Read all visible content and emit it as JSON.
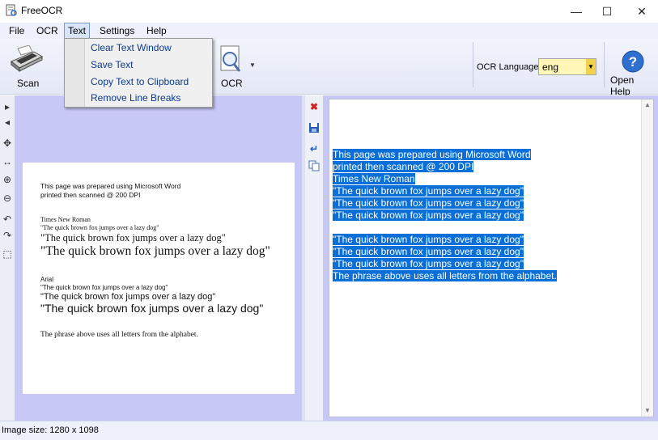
{
  "window": {
    "title": "FreeOCR",
    "minimize_glyph": "—",
    "maximize_glyph": "☐",
    "close_glyph": "✕"
  },
  "menu": {
    "items": [
      "File",
      "OCR",
      "Text",
      "Settings",
      "Help"
    ],
    "text_dropdown": [
      "Clear Text Window",
      "Save Text",
      "Copy Text to Clipboard",
      "Remove Line Breaks"
    ]
  },
  "toolbar": {
    "scan_label": "Scan",
    "ocr_label": "OCR",
    "ocr_language_label": "OCR Language:",
    "ocr_language_value": "eng",
    "help_label": "Open Help"
  },
  "document": {
    "lines": [
      "This page was prepared using Microsoft Word",
      "printed then scanned @ 200 DPI",
      "Times New Roman",
      "\"The quick brown fox jumps over a lazy dog\"",
      "\"The quick brown fox jumps over a lazy dog\"",
      "\"The quick brown fox jumps over a lazy dog\"",
      "Arial",
      "\"The quick brown fox jumps over a lazy dog\"",
      "\"The quick brown fox  jumps over a lazy dog\"",
      "\"The quick brown fox jumps over a lazy dog\"",
      "The phrase above uses all letters from the alphabet."
    ]
  },
  "ocr_text": {
    "lines": [
      "This page was prepared using Microsoft Word",
      "printed then scanned @ 200 DPI",
      "Times New Roman",
      "\"The quick brown fox jumps over a lazy dog\"",
      "\"The quick brown fox jumps over a lazy dog\"",
      "\"The quick brown fox jumps over a lazy dog\"",
      "\"The quick brown fox jumps over a lazy dog\"",
      "\"The quick brown fox jumps over a lazy dog\"",
      "\"The quick brown fox jumps over a lazy dog\"",
      "The phrase above uses all letters from the alphabet."
    ]
  },
  "statusbar": {
    "image_size": "Image size:  1280 x  1098"
  },
  "colors": {
    "pane_background": "#c8c8f6",
    "selection": "#0a6fd6",
    "language_select": "#fff6b8"
  },
  "icons": [
    "app-icon",
    "scanner-icon",
    "ocr-magnifier-icon",
    "help-icon",
    "delete-icon",
    "save-icon",
    "enter-icon",
    "copy-icon",
    "arrow-right-icon",
    "arrow-left-icon",
    "move-icon",
    "fit-width-icon",
    "zoom-in-icon",
    "zoom-out-icon",
    "rotate-left-icon",
    "rotate-right-icon",
    "select-rect-icon"
  ]
}
